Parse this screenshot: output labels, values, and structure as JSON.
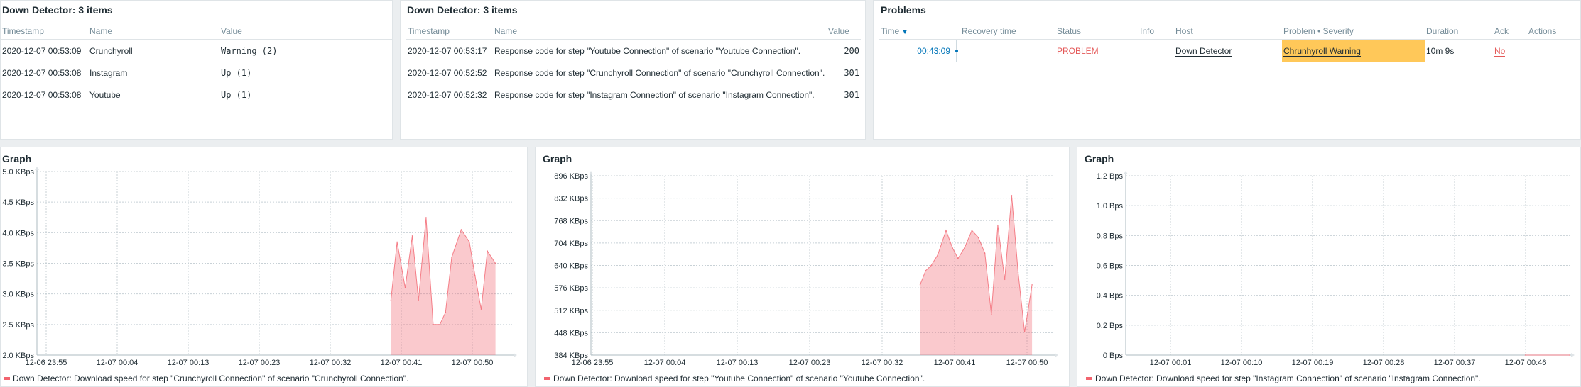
{
  "widget_latest_1": {
    "title": "Down Detector: 3 items",
    "columns": [
      "Timestamp",
      "Name",
      "Value"
    ],
    "rows": [
      {
        "timestamp": "2020-12-07 00:53:09",
        "name": "Crunchyroll",
        "value": "Warning (2)"
      },
      {
        "timestamp": "2020-12-07 00:53:08",
        "name": "Instagram",
        "value": "Up (1)"
      },
      {
        "timestamp": "2020-12-07 00:53:08",
        "name": "Youtube",
        "value": "Up (1)"
      }
    ]
  },
  "widget_latest_2": {
    "title": "Down Detector: 3 items",
    "columns": [
      "Timestamp",
      "Name",
      "Value"
    ],
    "rows": [
      {
        "timestamp": "2020-12-07 00:53:17",
        "name": "Response code for step \"Youtube Connection\" of scenario \"Youtube Connection\".",
        "value": "200"
      },
      {
        "timestamp": "2020-12-07 00:52:52",
        "name": "Response code for step \"Crunchyroll Connection\" of scenario \"Crunchyroll Connection\".",
        "value": "301"
      },
      {
        "timestamp": "2020-12-07 00:52:32",
        "name": "Response code for step \"Instagram Connection\" of scenario \"Instagram Connection\".",
        "value": "301"
      }
    ]
  },
  "widget_problems": {
    "title": "Problems",
    "columns": {
      "time": "Time",
      "recovery": "Recovery time",
      "status": "Status",
      "info": "Info",
      "host": "Host",
      "problem": "Problem • Severity",
      "duration": "Duration",
      "ack": "Ack",
      "actions": "Actions"
    },
    "sort_arrow": "▼",
    "row": {
      "time": "00:43:09",
      "recovery": "",
      "status": "PROBLEM",
      "info": "",
      "host": "Down Detector",
      "problem": "Chrunhyroll Warning",
      "duration": "10m 9s",
      "ack": "No",
      "actions": ""
    },
    "colors": {
      "status": "#e45959",
      "severity_warning": "#ffc859",
      "time_link": "#0275b8"
    }
  },
  "graph_crunchyroll": {
    "title": "Graph",
    "legend": "Down Detector: Download speed for step \"Crunchyroll Connection\" of scenario \"Crunchyroll Connection\".",
    "chart_data": {
      "type": "area",
      "color": "#f2646f",
      "ylim": [
        2.0,
        5.0
      ],
      "y_unit": "KBps",
      "y_ticks": [
        "5.0 KBps",
        "4.5 KBps",
        "4.0 KBps",
        "3.5 KBps",
        "3.0 KBps",
        "2.5 KBps",
        "2.0 KBps"
      ],
      "x_ticks": [
        "12-06 23:55",
        "12-07 00:04",
        "12-07 00:13",
        "12-07 00:23",
        "12-07 00:32",
        "12-07 00:41",
        "12-07 00:50"
      ],
      "x_range": [
        0,
        100
      ],
      "series": [
        {
          "values": [
            [
              0,
              null
            ],
            [
              74.5,
              2.9
            ],
            [
              75.8,
              3.85
            ],
            [
              77.5,
              3.1
            ],
            [
              79.0,
              3.95
            ],
            [
              80.3,
              2.9
            ],
            [
              81.9,
              4.25
            ],
            [
              83.4,
              2.5
            ],
            [
              84.8,
              2.5
            ],
            [
              86.0,
              2.7
            ],
            [
              87.3,
              3.6
            ],
            [
              89.3,
              4.05
            ],
            [
              91.0,
              3.85
            ],
            [
              92.2,
              3.3
            ],
            [
              93.5,
              2.75
            ],
            [
              94.8,
              3.7
            ],
            [
              96.5,
              3.5
            ]
          ]
        }
      ]
    }
  },
  "graph_youtube": {
    "title": "Graph",
    "legend": "Down Detector: Download speed for step \"Youtube Connection\" of scenario \"Youtube Connection\".",
    "chart_data": {
      "type": "area",
      "color": "#f2646f",
      "ylim": [
        384,
        896
      ],
      "y_unit": "KBps",
      "y_ticks": [
        "896 KBps",
        "832 KBps",
        "768 KBps",
        "704 KBps",
        "640 KBps",
        "576 KBps",
        "512 KBps",
        "448 KBps",
        "384 KBps"
      ],
      "x_ticks": [
        "12-06 23:55",
        "12-07 00:04",
        "12-07 00:13",
        "12-07 00:23",
        "12-07 00:32",
        "12-07 00:41",
        "12-07 00:50"
      ],
      "x_range": [
        0,
        100
      ],
      "series": [
        {
          "values": [
            [
              71.2,
              585
            ],
            [
              72.4,
              625
            ],
            [
              73.6,
              640
            ],
            [
              75.0,
              670
            ],
            [
              76.8,
              740
            ],
            [
              78.2,
              690
            ],
            [
              79.4,
              660
            ],
            [
              80.8,
              690
            ],
            [
              82.4,
              740
            ],
            [
              83.8,
              720
            ],
            [
              85.2,
              675
            ],
            [
              86.6,
              500
            ],
            [
              88.0,
              755
            ],
            [
              89.5,
              600
            ],
            [
              91.0,
              840
            ],
            [
              92.4,
              620
            ],
            [
              93.8,
              450
            ],
            [
              95.4,
              585
            ]
          ]
        }
      ]
    }
  },
  "graph_instagram": {
    "title": "Graph",
    "legend": "Down Detector: Download speed for step \"Instagram Connection\" of scenario \"Instagram Connection\".",
    "chart_data": {
      "type": "area",
      "color": "#f2646f",
      "ylim": [
        0,
        1.2
      ],
      "y_unit": "Bps",
      "y_ticks": [
        "1.2 Bps",
        "1.0 Bps",
        "0.8 Bps",
        "0.6 Bps",
        "0.4 Bps",
        "0.2 Bps",
        "0 Bps"
      ],
      "x_ticks": [
        "12-07 00:01",
        "12-07 00:10",
        "12-07 00:19",
        "12-07 00:28",
        "12-07 00:37",
        "12-07 00:46"
      ],
      "x_range": [
        0,
        100
      ],
      "series": [
        {
          "values": [
            [
              90,
              0
            ],
            [
              100,
              0
            ]
          ]
        }
      ]
    }
  }
}
